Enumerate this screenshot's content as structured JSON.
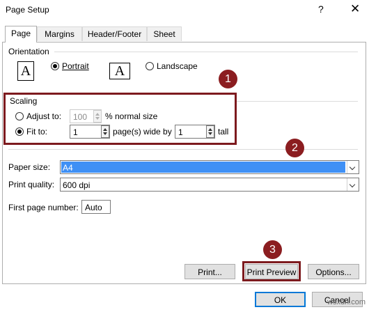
{
  "window": {
    "title": "Page Setup",
    "help_glyph": "?",
    "close_glyph": "✕"
  },
  "tabs": [
    {
      "label": "Page",
      "active": true
    },
    {
      "label": "Margins",
      "active": false
    },
    {
      "label": "Header/Footer",
      "active": false
    },
    {
      "label": "Sheet",
      "active": false
    }
  ],
  "orientation": {
    "label": "Orientation",
    "icon_letter": "A",
    "portrait_label": "Portrait",
    "landscape_label": "Landscape",
    "selected": "Portrait"
  },
  "scaling": {
    "label": "Scaling",
    "adjust_to_label": "Adjust to:",
    "adjust_value": "100",
    "adjust_suffix": "% normal size",
    "fit_to_label": "Fit to:",
    "fit_wide_value": "1",
    "fit_mid_label": "page(s) wide by",
    "fit_tall_value": "1",
    "fit_tall_label": "tall",
    "selected": "Fit to"
  },
  "paper_size": {
    "label": "Paper size:",
    "value": "A4"
  },
  "print_quality": {
    "label": "Print quality:",
    "value": "600 dpi"
  },
  "first_page": {
    "label": "First page number:",
    "value": "Auto"
  },
  "buttons": {
    "print": "Print...",
    "print_preview": "Print Preview",
    "options": "Options...",
    "ok": "OK",
    "cancel": "Cancel"
  },
  "markers": [
    "1",
    "2",
    "3"
  ],
  "watermark": "wsxdn.com",
  "colors": {
    "annotation_red": "#8b1d20",
    "selection_blue": "#3f90f5",
    "default_button_border": "#0078d7"
  }
}
